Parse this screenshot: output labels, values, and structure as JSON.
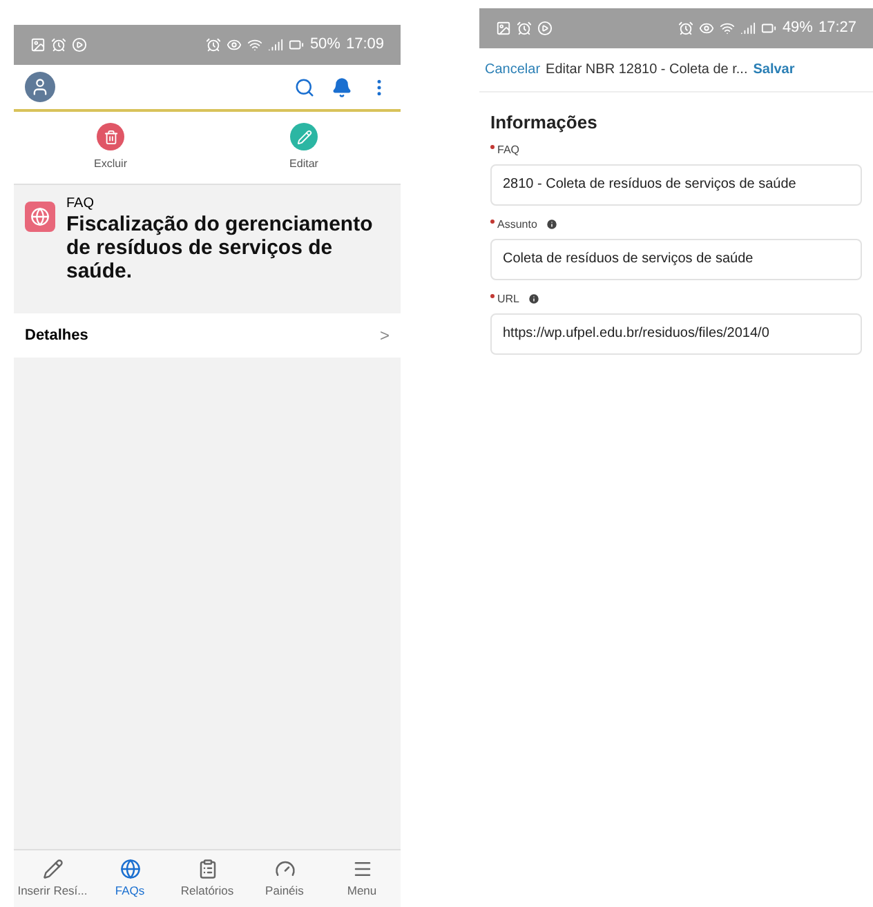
{
  "left_screen": {
    "status_bar": {
      "battery": "50%",
      "time": "17:09"
    },
    "actions": [
      {
        "label": "Excluir",
        "kind": "delete"
      },
      {
        "label": "Editar",
        "kind": "edit"
      }
    ],
    "record": {
      "type": "FAQ",
      "title": "Fiscalização do gerenciamento de resíduos de serviços de saúde."
    },
    "details": {
      "label": "Detalhes",
      "chevron": ">"
    },
    "tab_bar": [
      {
        "label": "Inserir Resí...",
        "kind": "pencil",
        "selected": false
      },
      {
        "label": "FAQs",
        "kind": "globe",
        "selected": true
      },
      {
        "label": "Relatórios",
        "kind": "report",
        "selected": false
      },
      {
        "label": "Painéis",
        "kind": "gauge",
        "selected": false
      },
      {
        "label": "Menu",
        "kind": "menu",
        "selected": false
      }
    ]
  },
  "right_screen": {
    "status_bar": {
      "battery": "49%",
      "time": "17:27"
    },
    "nav": {
      "cancel": "Cancelar",
      "title": "Editar NBR 12810 - Coleta de r...",
      "save": "Salvar"
    },
    "section": "Informações",
    "fields": [
      {
        "label": "FAQ",
        "required": true,
        "info": false,
        "value": "2810 - Coleta de resíduos de serviços de saúde"
      },
      {
        "label": "Assunto",
        "required": true,
        "info": true,
        "value": "Coleta de resíduos de serviços de saúde"
      },
      {
        "label": "URL",
        "required": true,
        "info": true,
        "value": "https://wp.ufpel.edu.br/residuos/files/2014/0"
      }
    ]
  }
}
